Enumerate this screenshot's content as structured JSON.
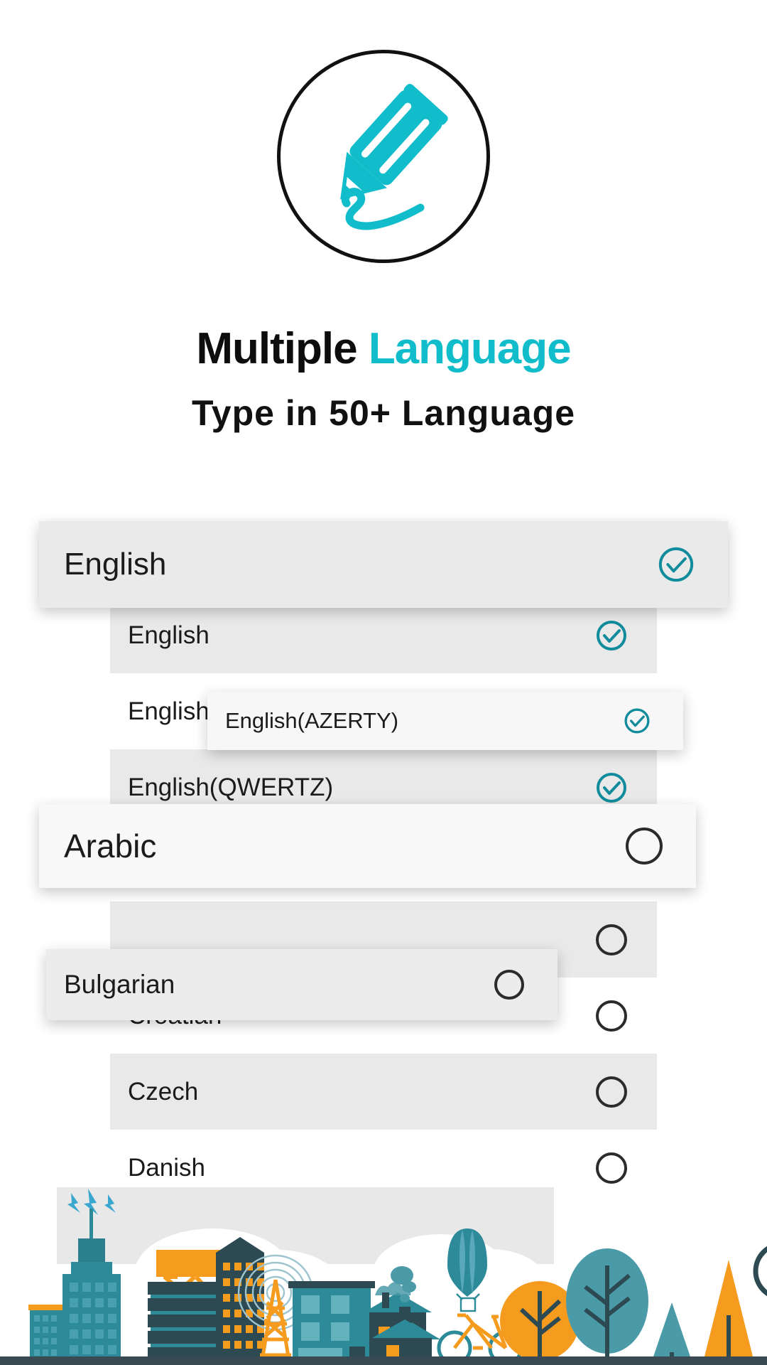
{
  "app": {
    "logo_icon": "pencil-logo-icon",
    "accent_color": "#12BDCB",
    "check_color": "#108C9C",
    "list_bg_alt": "#e9e9e9"
  },
  "header": {
    "title_main": "Multiple",
    "title_accent": "Language",
    "subtitle": "Type in 50+ Language"
  },
  "language_list": {
    "rows": [
      {
        "label": "English",
        "state": "checked"
      },
      {
        "label": "English(",
        "state": "checked"
      },
      {
        "label": "English(QWERTZ)",
        "state": "checked"
      },
      {
        "label": "Bulgarian",
        "state": "unchecked"
      },
      {
        "label": "",
        "state": "unchecked"
      },
      {
        "label": "Croatian",
        "state": "unchecked"
      },
      {
        "label": "Czech",
        "state": "unchecked"
      },
      {
        "label": "Danish",
        "state": "unchecked"
      }
    ]
  },
  "floating_cards": [
    {
      "label": "English",
      "state": "checked"
    },
    {
      "label": "English(AZERTY)",
      "state": "checked"
    },
    {
      "label": "Arabic",
      "state": "unchecked"
    },
    {
      "label": "Bulgarian",
      "state": "unchecked"
    }
  ],
  "illustration": {
    "name": "city-and-nature-scene",
    "colors": {
      "teal_dark": "#2d4a53",
      "teal": "#2c8a99",
      "teal_light": "#48a0ae",
      "orange": "#f59b1e",
      "ground": "#3a4a52",
      "cloud": "#ffffff",
      "band": "#e8e8e8"
    },
    "elements": [
      "skyscraper",
      "water-tower",
      "apartment-block",
      "radio-tower",
      "airplane",
      "hot-air-balloon",
      "trees",
      "house",
      "bicycle",
      "mountain",
      "tunnel",
      "train",
      "lightning-bolts",
      "clouds"
    ]
  }
}
